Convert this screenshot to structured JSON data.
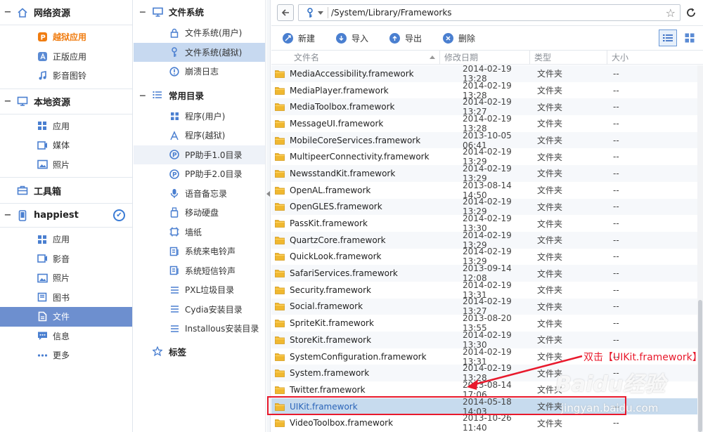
{
  "leftnav": {
    "sections": [
      {
        "label": "网络资源",
        "icon": "home-icon",
        "items": [
          {
            "label": "越狱应用",
            "icon": "pp-icon",
            "style": "orange"
          },
          {
            "label": "正版应用",
            "icon": "app-store-icon"
          },
          {
            "label": "影音图铃",
            "icon": "music-note-icon"
          }
        ]
      },
      {
        "label": "本地资源",
        "icon": "monitor-icon",
        "items": [
          {
            "label": "应用",
            "icon": "apps-grid-icon"
          },
          {
            "label": "媒体",
            "icon": "media-icon"
          },
          {
            "label": "照片",
            "icon": "photo-icon"
          }
        ]
      },
      {
        "label": "工具箱",
        "icon": "toolbox-icon",
        "items": []
      },
      {
        "label": "happiest",
        "icon": "phone-icon",
        "connected": true,
        "items": [
          {
            "label": "应用",
            "icon": "apps-grid-icon"
          },
          {
            "label": "影音",
            "icon": "video-icon"
          },
          {
            "label": "照片",
            "icon": "photo-icon"
          },
          {
            "label": "图书",
            "icon": "book-icon"
          },
          {
            "label": "文件",
            "icon": "file-icon",
            "active": true
          },
          {
            "label": "信息",
            "icon": "message-icon"
          },
          {
            "label": "更多",
            "icon": "more-icon"
          }
        ]
      }
    ]
  },
  "tree": {
    "filesystem": {
      "label": "文件系统",
      "items": [
        {
          "label": "文件系统(用户)",
          "icon": "lock-icon"
        },
        {
          "label": "文件系统(越狱)",
          "icon": "key-icon",
          "selected": true
        },
        {
          "label": "崩溃日志",
          "icon": "alert-icon"
        }
      ]
    },
    "common": {
      "label": "常用目录",
      "items": [
        {
          "label": "程序(用户)",
          "icon": "apps-grid-icon"
        },
        {
          "label": "程序(越狱)",
          "icon": "tool-icon"
        },
        {
          "label": "PP助手1.0目录",
          "icon": "pp-icon",
          "highlight": true
        },
        {
          "label": "PP助手2.0目录",
          "icon": "pp-icon"
        },
        {
          "label": "语音备忘录",
          "icon": "microphone-icon"
        },
        {
          "label": "移动硬盘",
          "icon": "usb-drive-icon"
        },
        {
          "label": "墙纸",
          "icon": "wallpaper-icon"
        },
        {
          "label": "系统来电铃声",
          "icon": "ringtone-icon"
        },
        {
          "label": "系统短信铃声",
          "icon": "sms-tone-icon"
        },
        {
          "label": "PXL垃圾目录",
          "icon": "list-icon"
        },
        {
          "label": "Cydia安装目录",
          "icon": "list-icon"
        },
        {
          "label": "Installous安装目录",
          "icon": "list-icon"
        }
      ]
    },
    "bookmarks": {
      "label": "标签"
    }
  },
  "address": {
    "path": "/System/Library/Frameworks"
  },
  "toolbar": {
    "new": "新建",
    "import": "导入",
    "export": "导出",
    "delete": "删除"
  },
  "columns": {
    "name": "文件名",
    "date": "修改日期",
    "type": "类型",
    "size": "大小"
  },
  "files": [
    {
      "name": "MediaAccessibility.framework",
      "date": "2014-02-19 13:28",
      "type": "文件夹",
      "size": "--"
    },
    {
      "name": "MediaPlayer.framework",
      "date": "2014-02-19 13:28",
      "type": "文件夹",
      "size": "--"
    },
    {
      "name": "MediaToolbox.framework",
      "date": "2014-02-19 13:27",
      "type": "文件夹",
      "size": "--"
    },
    {
      "name": "MessageUI.framework",
      "date": "2014-02-19 13:28",
      "type": "文件夹",
      "size": "--"
    },
    {
      "name": "MobileCoreServices.framework",
      "date": "2013-10-05 06:41",
      "type": "文件夹",
      "size": "--"
    },
    {
      "name": "MultipeerConnectivity.framework",
      "date": "2014-02-19 13:29",
      "type": "文件夹",
      "size": "--"
    },
    {
      "name": "NewsstandKit.framework",
      "date": "2014-02-19 13:29",
      "type": "文件夹",
      "size": "--"
    },
    {
      "name": "OpenAL.framework",
      "date": "2013-08-14 14:50",
      "type": "文件夹",
      "size": "--"
    },
    {
      "name": "OpenGLES.framework",
      "date": "2014-02-19 13:29",
      "type": "文件夹",
      "size": "--"
    },
    {
      "name": "PassKit.framework",
      "date": "2014-02-19 13:30",
      "type": "文件夹",
      "size": "--"
    },
    {
      "name": "QuartzCore.framework",
      "date": "2014-02-19 13:29",
      "type": "文件夹",
      "size": "--"
    },
    {
      "name": "QuickLook.framework",
      "date": "2014-02-19 13:29",
      "type": "文件夹",
      "size": "--"
    },
    {
      "name": "SafariServices.framework",
      "date": "2013-09-14 12:08",
      "type": "文件夹",
      "size": "--"
    },
    {
      "name": "Security.framework",
      "date": "2014-02-19 13:31",
      "type": "文件夹",
      "size": "--"
    },
    {
      "name": "Social.framework",
      "date": "2014-02-19 13:27",
      "type": "文件夹",
      "size": "--"
    },
    {
      "name": "SpriteKit.framework",
      "date": "2013-08-20 13:55",
      "type": "文件夹",
      "size": "--"
    },
    {
      "name": "StoreKit.framework",
      "date": "2014-02-19 13:30",
      "type": "文件夹",
      "size": "--"
    },
    {
      "name": "SystemConfiguration.framework",
      "date": "2014-02-19 13:31",
      "type": "文件夹",
      "size": "--"
    },
    {
      "name": "System.framework",
      "date": "2014-02-19 13:28",
      "type": "文件夹",
      "size": "--"
    },
    {
      "name": "Twitter.framework",
      "date": "2013-08-14 17:06",
      "type": "文件夹",
      "size": "--"
    },
    {
      "name": "UIKit.framework",
      "date": "2014-05-18 14:03",
      "type": "文件夹",
      "size": "--",
      "selected": true
    },
    {
      "name": "VideoToolbox.framework",
      "date": "2013-10-26 11:40",
      "type": "文件夹",
      "size": "--"
    }
  ],
  "annotation": {
    "text": "双击【UIKit.framework】",
    "color": "#e8192c"
  },
  "watermark": {
    "brand": "Baidu经验",
    "url": "jingyan.baidu.com"
  },
  "colors": {
    "accent": "#4a7fd0",
    "active_nav": "#6d8fcf",
    "selected_row": "#c7dbee",
    "orange": "#f07c10"
  }
}
